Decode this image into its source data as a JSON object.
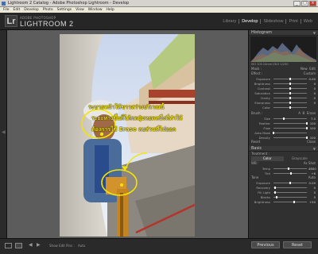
{
  "window": {
    "title": "Lightroom 2 Catalog - Adobe Photoshop Lightroom - Develop"
  },
  "menu": [
    "File",
    "Edit",
    "Develop",
    "Photo",
    "Settings",
    "View",
    "Window",
    "Help"
  ],
  "logo": {
    "glyph": "Lr",
    "subtitle": "ADOBE PHOTOSHOP",
    "title": "LIGHTROOM 2"
  },
  "modules": [
    "Library",
    "Develop",
    "Slideshow",
    "Print",
    "Web"
  ],
  "active_module": "Develop",
  "annotation": {
    "lines": [
      "ระบายหน้าให้ขาวสว่างบริเวณนี้",
      "ระยะห่างขึ้นก็ได้กดปุ่มหยดหนึ่งที่ทำให้",
      "ต้องการใช้ Erase ลบส่วนที่ไม่ออก"
    ],
    "color": "#f5e400"
  },
  "panels": {
    "histogram": {
      "title": "Histogram",
      "info": "ISO 100   24mm   f/8.0   1/250"
    },
    "mask": {
      "new": "Mask :",
      "new_btn": "New",
      "edit_btn": "Edit"
    },
    "effect_title": "Effect :",
    "effect_preset": "Custom",
    "sliders": [
      {
        "label": "Exposure",
        "value": "0.00",
        "pos": 0.5
      },
      {
        "label": "Brightness",
        "value": "0",
        "pos": 0.5
      },
      {
        "label": "Contrast",
        "value": "0",
        "pos": 0.5
      },
      {
        "label": "Saturation",
        "value": "0",
        "pos": 0.5
      },
      {
        "label": "Clarity",
        "value": "0",
        "pos": 0.5
      },
      {
        "label": "Sharpness",
        "value": "0",
        "pos": 0.5
      },
      {
        "label": "Color",
        "value": "",
        "pos": 0.5
      }
    ],
    "brush": {
      "title": "Brush :",
      "a": "A",
      "b": "B",
      "erase": "Erase"
    },
    "brush_sliders": [
      {
        "label": "Size",
        "value": "7.0",
        "pos": 0.3
      },
      {
        "label": "Feather",
        "value": "100",
        "pos": 1.0
      },
      {
        "label": "Flow",
        "value": "100",
        "pos": 1.0
      },
      {
        "label": "Auto Mask",
        "value": "",
        "pos": 0
      },
      {
        "label": "Density",
        "value": "100",
        "pos": 1.0
      }
    ],
    "reset_close": {
      "reset": "Reset",
      "close": "Close"
    },
    "basic": {
      "title": "Basic",
      "treatment": "Treatment :",
      "color": "Color",
      "grayscale": "Grayscale"
    },
    "wb": {
      "label": "WB :",
      "value": "As Shot"
    },
    "temp_sliders": [
      {
        "label": "Temp",
        "value": "4800",
        "pos": 0.45
      },
      {
        "label": "Tint",
        "value": "+6",
        "pos": 0.52
      }
    ],
    "tone": {
      "title": "Tone",
      "auto": "Auto"
    },
    "tone_sliders": [
      {
        "label": "Exposure",
        "value": "0.00",
        "pos": 0.5
      },
      {
        "label": "Recovery",
        "value": "0",
        "pos": 0.05
      },
      {
        "label": "Fill Light",
        "value": "0",
        "pos": 0.05
      },
      {
        "label": "Blacks",
        "value": "5",
        "pos": 0.1
      },
      {
        "label": "Brightness",
        "value": "+50",
        "pos": 0.62
      }
    ]
  },
  "bottom": {
    "toolbar_label": "Show Edit Pins :",
    "toolbar_value": "Auto",
    "previous": "Previous",
    "reset": "Reset"
  }
}
